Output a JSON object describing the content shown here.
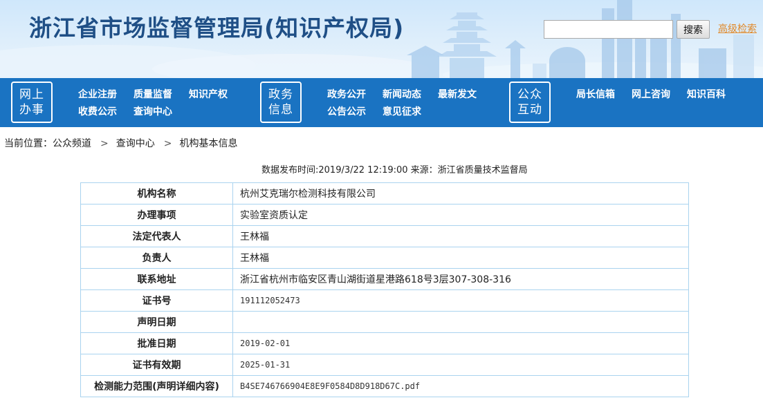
{
  "header": {
    "site_title": "浙江省市场监督管理局(知识产权局)",
    "search_placeholder": "",
    "search_button": "搜索",
    "advanced_search": "高级检索"
  },
  "nav": {
    "group1": {
      "badge_line1": "网上",
      "badge_line2": "办事",
      "links": [
        "企业注册",
        "质量监督",
        "知识产权",
        "收费公示",
        "查询中心"
      ]
    },
    "group2": {
      "badge_line1": "政务",
      "badge_line2": "信息",
      "links": [
        "政务公开",
        "新闻动态",
        "最新发文",
        "公告公示",
        "意见征求"
      ]
    },
    "group3": {
      "badge_line1": "公众",
      "badge_line2": "互动",
      "links": [
        "局长信箱",
        "网上咨询",
        "知识百科"
      ]
    }
  },
  "breadcrumb": {
    "prefix": "当前位置：",
    "items": [
      "公众频道",
      "查询中心",
      "机构基本信息"
    ],
    "separator": ">"
  },
  "publish_line": "数据发布时间:2019/3/22 12:19:00 来源：浙江省质量技术监督局",
  "record": {
    "rows": [
      {
        "label": "机构名称",
        "value": "杭州艾克瑞尔检测科技有限公司"
      },
      {
        "label": "办理事项",
        "value": "实验室资质认定"
      },
      {
        "label": "法定代表人",
        "value": "王林福"
      },
      {
        "label": "负责人",
        "value": "王林福"
      },
      {
        "label": "联系地址",
        "value": "浙江省杭州市临安区青山湖街道星港路618号3层307-308-316"
      },
      {
        "label": "证书号",
        "value": "191112052473"
      },
      {
        "label": "声明日期",
        "value": ""
      },
      {
        "label": "批准日期",
        "value": "2019-02-01"
      },
      {
        "label": "证书有效期",
        "value": "2025-01-31"
      },
      {
        "label": "检测能力范围(声明详细内容)",
        "value": "B4SE746766904E8E9F0584D8D918D67C.pdf"
      }
    ]
  },
  "colors": {
    "title": "#1f4f86",
    "nav_bg": "#1a73c2",
    "advanced_search": "#e0892a",
    "table_border": "#a9d3ef"
  }
}
